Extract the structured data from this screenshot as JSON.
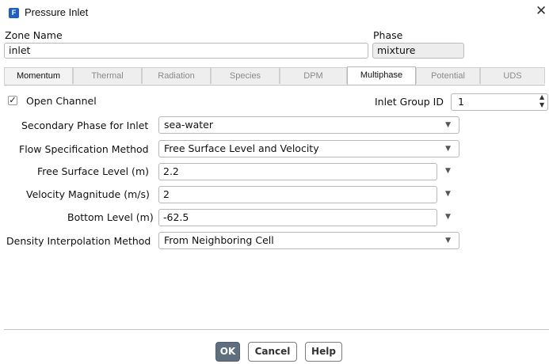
{
  "window": {
    "title": "Pressure Inlet",
    "icon_letter": "F",
    "close_symbol": "✕"
  },
  "zone": {
    "label": "Zone Name",
    "value": "inlet"
  },
  "phase": {
    "label": "Phase",
    "value": "mixture"
  },
  "tabs": [
    {
      "label": "Momentum"
    },
    {
      "label": "Thermal"
    },
    {
      "label": "Radiation"
    },
    {
      "label": "Species"
    },
    {
      "label": "DPM"
    },
    {
      "label": "Multiphase"
    },
    {
      "label": "Potential"
    },
    {
      "label": "UDS"
    }
  ],
  "selected_tab": "Multiphase",
  "open_channel": {
    "label": "Open Channel",
    "checked": true,
    "check_symbol": "✓"
  },
  "inlet_group": {
    "label": "Inlet Group ID",
    "value": "1"
  },
  "form": {
    "secondary_phase": {
      "label": "Secondary Phase for Inlet",
      "value": "sea-water"
    },
    "flow_spec": {
      "label": "Flow Specification Method",
      "value": "Free Surface Level and Velocity"
    },
    "free_surface": {
      "label": "Free Surface Level (m)",
      "value": "2.2"
    },
    "velocity": {
      "label": "Velocity Magnitude (m/s)",
      "value": "2"
    },
    "bottom_level": {
      "label": "Bottom Level (m)",
      "value": "-62.5"
    },
    "density_interp": {
      "label": "Density Interpolation Method",
      "value": "From Neighboring Cell"
    }
  },
  "buttons": {
    "ok": "OK",
    "cancel": "Cancel",
    "help": "Help"
  },
  "colors": {
    "ok_button": "#5f6f80",
    "app_icon": "#1d5fc2"
  },
  "icons": {
    "dropdown": "chevron-down-icon",
    "spin": "spin-arrows-icon",
    "close": "close-icon"
  }
}
